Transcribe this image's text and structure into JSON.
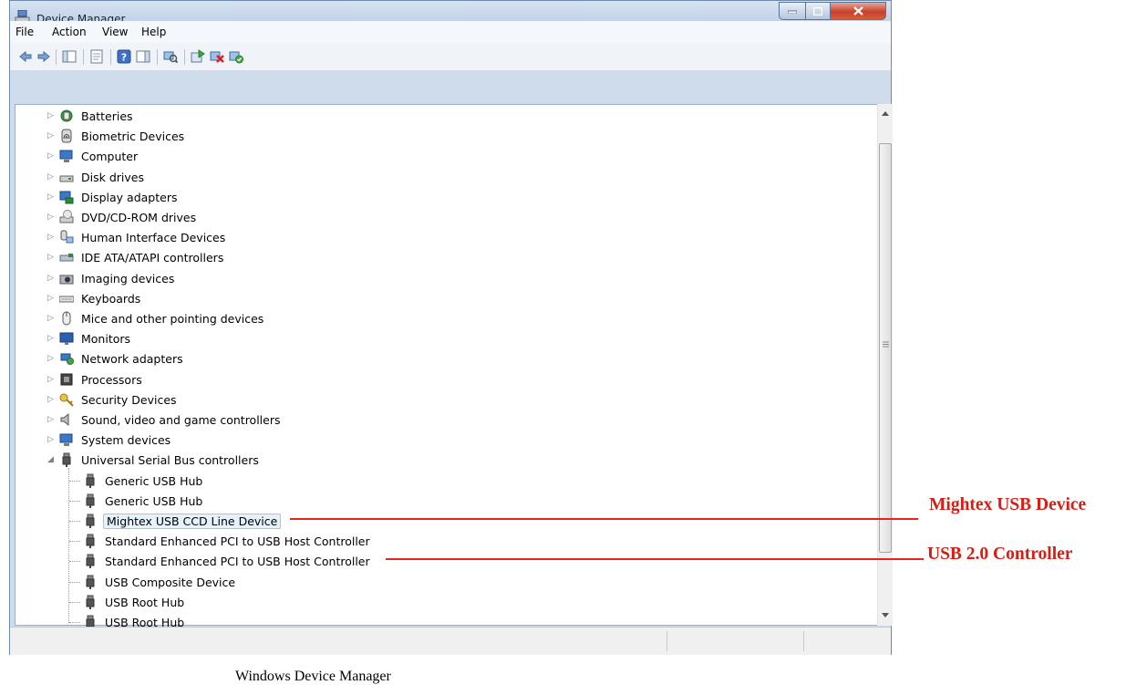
{
  "window": {
    "title": "Device Manager"
  },
  "menu": [
    "File",
    "Action",
    "View",
    "Help"
  ],
  "toolbar_icons": [
    "back-arrow-icon",
    "forward-arrow-icon",
    "show-hide-tree-icon",
    "properties-icon",
    "help-icon",
    "action-pane-icon",
    "scan-hardware-icon",
    "update-driver-icon",
    "uninstall-icon",
    "enable-device-icon"
  ],
  "tree": {
    "categories": [
      {
        "label": "Batteries",
        "icon": "battery-icon"
      },
      {
        "label": "Biometric Devices",
        "icon": "fingerprint-icon"
      },
      {
        "label": "Computer",
        "icon": "computer-icon"
      },
      {
        "label": "Disk drives",
        "icon": "disk-drive-icon"
      },
      {
        "label": "Display adapters",
        "icon": "display-adapter-icon"
      },
      {
        "label": "DVD/CD-ROM drives",
        "icon": "dvd-drive-icon"
      },
      {
        "label": "Human Interface Devices",
        "icon": "hid-icon"
      },
      {
        "label": "IDE ATA/ATAPI controllers",
        "icon": "ide-controller-icon"
      },
      {
        "label": "Imaging devices",
        "icon": "camera-icon"
      },
      {
        "label": "Keyboards",
        "icon": "keyboard-icon"
      },
      {
        "label": "Mice and other pointing devices",
        "icon": "mouse-icon"
      },
      {
        "label": "Monitors",
        "icon": "monitor-icon"
      },
      {
        "label": "Network adapters",
        "icon": "network-adapter-icon"
      },
      {
        "label": "Processors",
        "icon": "processor-icon"
      },
      {
        "label": "Security Devices",
        "icon": "key-icon"
      },
      {
        "label": "Sound, video and game controllers",
        "icon": "speaker-icon"
      },
      {
        "label": "System devices",
        "icon": "system-device-icon"
      },
      {
        "label": "Universal Serial Bus controllers",
        "icon": "usb-plug-icon"
      }
    ],
    "usb_children": [
      "Generic USB Hub",
      "Generic USB Hub",
      "Mightex USB CCD Line Device",
      "Standard Enhanced PCI to USB Host Controller",
      "Standard Enhanced PCI to USB Host Controller",
      "USB Composite Device",
      "USB Root Hub",
      "USB Root Hub"
    ],
    "selected_index": 2
  },
  "annotations": {
    "mightex": "Mightex USB Device",
    "controller": "USB 2.0 Controller",
    "color": "#d81e12"
  },
  "figure_caption": "Windows Device Manager"
}
